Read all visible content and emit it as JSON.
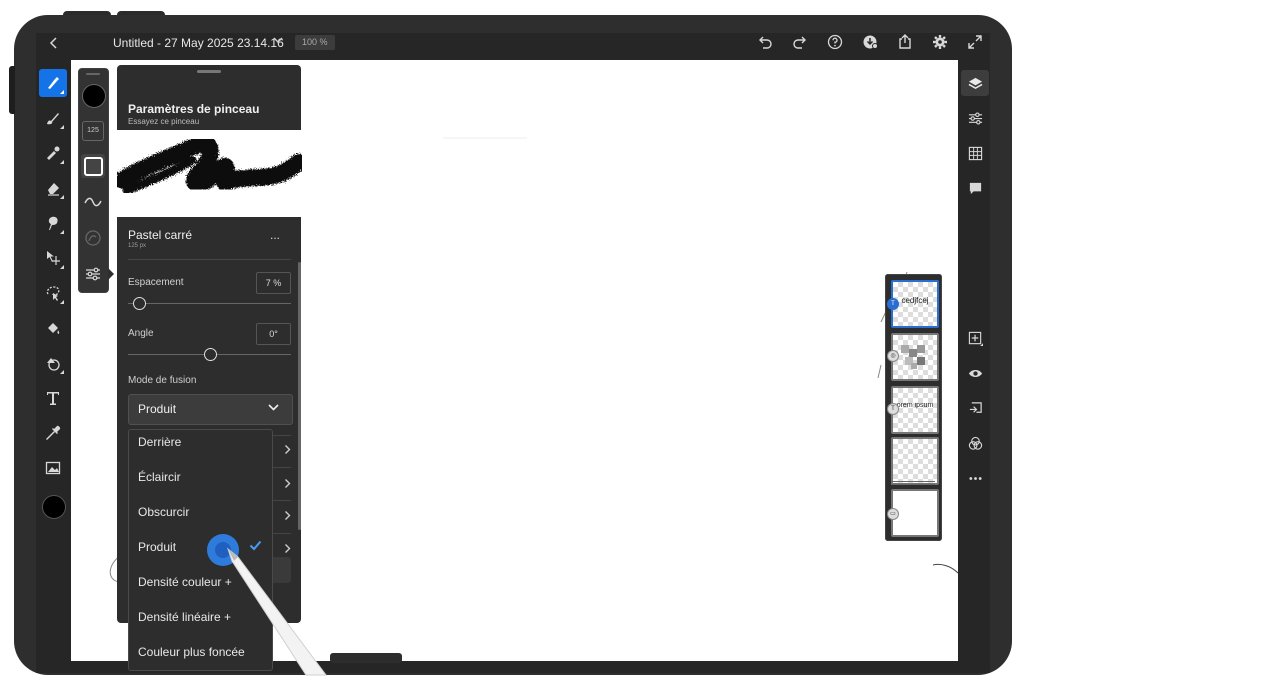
{
  "topbar": {
    "back_icon": "chevron-left-icon",
    "title": "Untitled - 27 May 2025 23.14.16",
    "zoom": "100 %",
    "icons": [
      "undo-icon",
      "redo-icon",
      "help-icon",
      "cloud-sync-icon",
      "share-icon",
      "settings-gear-icon",
      "fullscreen-icon"
    ]
  },
  "left_toolbar": {
    "tools": [
      "paint-brush-icon",
      "pixel-brush-icon",
      "mixer-brush-icon",
      "eraser-icon",
      "smudge-icon",
      "move-icon",
      "lasso-icon",
      "fill-bucket-icon",
      "shape-icon",
      "type-icon",
      "eyedropper-icon",
      "image-icon"
    ],
    "color": "#000000"
  },
  "mini_panel": {
    "size": "125"
  },
  "brush_settings": {
    "title": "Paramètres de pinceau",
    "subtitle": "Essayez ce pinceau",
    "brush_name": "Pastel carré",
    "brush_size": "125 px",
    "more": "...",
    "spacing_label": "Espacement",
    "spacing_value": "7 %",
    "spacing_fraction": 0.07,
    "angle_label": "Angle",
    "angle_value": "0°",
    "angle_fraction": 0.5,
    "blend_label": "Mode de fusion",
    "blend_value": "Produit"
  },
  "blend_dropdown": {
    "options": [
      "Derrière",
      "Éclaircir",
      "Obscurcir",
      "Produit",
      "Densité couleur +",
      "Densité linéaire +",
      "Couleur plus foncée"
    ],
    "selected": "Produit"
  },
  "layers": {
    "items": [
      {
        "text": "cedjfcej",
        "badge": "T"
      },
      {
        "text": "",
        "badge": "◎"
      },
      {
        "text": "orem ipsum",
        "badge": "T"
      },
      {
        "text": "",
        "badge": ""
      },
      {
        "text": "",
        "badge": "▭"
      }
    ]
  },
  "right_toolbar": {
    "top": [
      "layers-icon",
      "adjustments-icon",
      "grid-icon",
      "comment-icon"
    ],
    "bottom": [
      "add-layer-icon",
      "visibility-icon",
      "layer-properties-icon",
      "blend-icon",
      "more-icon"
    ]
  },
  "colors": {
    "accent": "#1473e6",
    "ui_dark": "#262626",
    "panel": "#2d2d2d"
  }
}
